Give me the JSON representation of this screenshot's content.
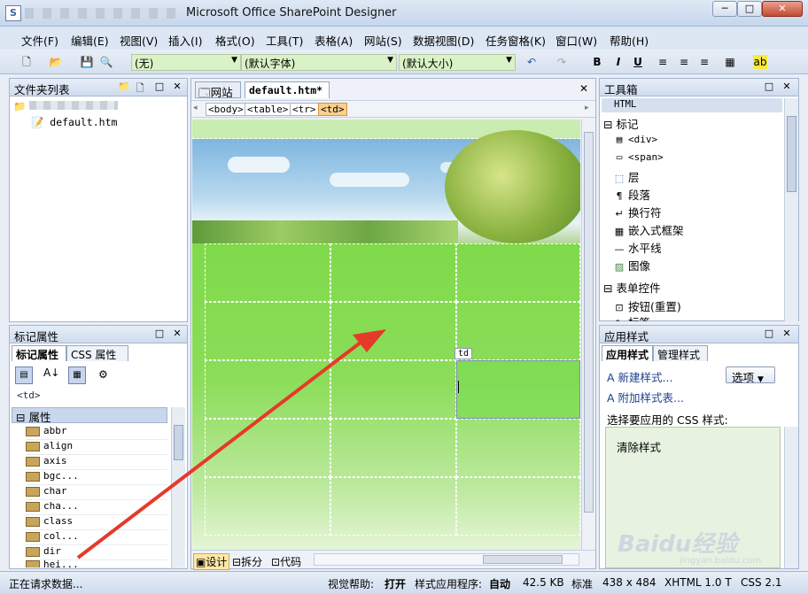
{
  "app": {
    "title": "Microsoft Office SharePoint Designer",
    "icon_name": "sharepoint-designer-icon"
  },
  "window_controls": {
    "minimize": "─",
    "maximize": "□",
    "close": "✕"
  },
  "menu": [
    "文件(F)",
    "编辑(E)",
    "视图(V)",
    "插入(I)",
    "格式(O)",
    "工具(T)",
    "表格(A)",
    "网站(S)",
    "数据视图(D)",
    "任务窗格(K)",
    "窗口(W)",
    "帮助(H)"
  ],
  "toolbar": {
    "style_combo": "(无)",
    "font_combo": "(默认字体)",
    "size_combo": "(默认大小)",
    "bold": "B",
    "italic": "I",
    "underline": "U"
  },
  "folder_list": {
    "title": "文件夹列表",
    "files": [
      "default.htm"
    ]
  },
  "tag_props": {
    "title": "标记属性",
    "tabs": [
      "标记属性",
      "CSS 属性"
    ],
    "current_tag": "<td>",
    "group": "属性",
    "items": [
      "abbr",
      "align",
      "axis",
      "bgc...",
      "char",
      "cha...",
      "class",
      "col...",
      "dir",
      "hei..."
    ]
  },
  "editor": {
    "tabs": [
      "网站",
      "default.htm*"
    ],
    "breadcrumb": [
      "<body>",
      "<table>",
      "<tr>",
      "<td>"
    ],
    "cell_label": "td",
    "view_tabs": [
      "设计",
      "拆分",
      "代码"
    ]
  },
  "toolbox": {
    "title": "工具箱",
    "html_header": "HTML",
    "tags_group": "标记",
    "tags": [
      "<div>",
      "<span>",
      "层",
      "段落",
      "换行符",
      "嵌入式框架",
      "水平线",
      "图像"
    ],
    "forms_group": "表单控件",
    "forms": [
      "按钮(重置)",
      "标签"
    ]
  },
  "apply_styles": {
    "title": "应用样式",
    "tabs": [
      "应用样式",
      "管理样式"
    ],
    "new_style": "新建样式...",
    "attach": "附加样式表...",
    "options": "选项",
    "select_label": "选择要应用的 CSS 样式:",
    "clear": "清除样式"
  },
  "status": {
    "left": "正在请求数据...",
    "visual_aid_label": "视觉帮助:",
    "visual_aid_value": "打开",
    "style_app_label": "样式应用程序:",
    "style_app_value": "自动",
    "size": "42.5 KB",
    "mode": "标准",
    "dims": "438 x 484",
    "doctype": "XHTML 1.0 T",
    "css": "CSS 2.1"
  },
  "watermark": {
    "text": "Baidu经验",
    "url": "jingyan.baidu.com"
  },
  "colors": {
    "accent_arrow": "#e53a2a",
    "canvas_green": "#7fda4a"
  }
}
